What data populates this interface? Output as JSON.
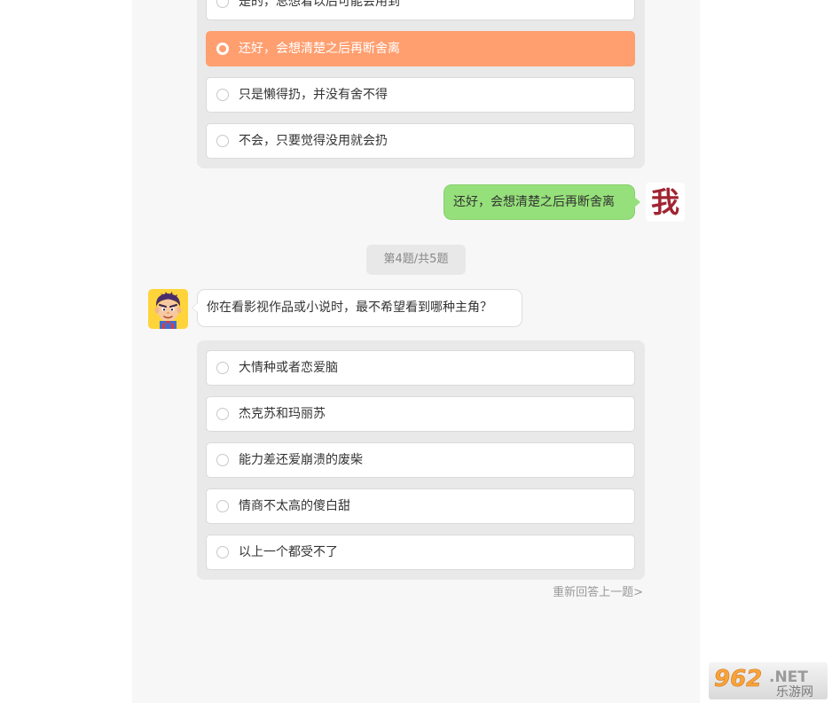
{
  "prev_question": {
    "options": [
      {
        "label": "是的，总想着以后可能会用到",
        "selected": false
      },
      {
        "label": "还好，会想清楚之后再断舍离",
        "selected": true
      },
      {
        "label": "只是懒得扔，并没有舍不得",
        "selected": false
      },
      {
        "label": "不会，只要觉得没用就会扔",
        "selected": false
      }
    ]
  },
  "my_reply": {
    "text": "还好，会想清楚之后再断舍离",
    "avatar_text": "我"
  },
  "progress_label": "第4题/共5题",
  "question": {
    "text": "你在看影视作品或小说时，最不希望看到哪种主角？",
    "options": [
      {
        "label": "大情种或者恋爱脑"
      },
      {
        "label": "杰克苏和玛丽苏"
      },
      {
        "label": "能力差还爱崩溃的废柴"
      },
      {
        "label": "情商不太高的傻白甜"
      },
      {
        "label": "以上一个都受不了"
      }
    ]
  },
  "redo_link": "重新回答上一题>",
  "watermark": {
    "number": "962",
    "suffix": ".NET",
    "sub": "乐游网"
  },
  "colors": {
    "selected_option": "#ff9f70",
    "my_bubble": "#95e07a",
    "avatar_char": "#a12432",
    "bot_avatar_bg": "#ffd43a"
  }
}
